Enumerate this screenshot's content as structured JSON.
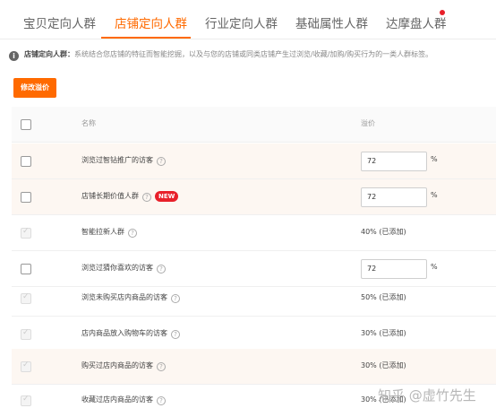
{
  "tabs": [
    {
      "label": "宝贝定向人群"
    },
    {
      "label": "店铺定向人群"
    },
    {
      "label": "行业定向人群"
    },
    {
      "label": "基础属性人群"
    },
    {
      "label": "达摩盘人群"
    }
  ],
  "active_tab": "店铺定向人群",
  "colors": {
    "accent": "#ff6a00",
    "badge": "#e8202a"
  },
  "info": {
    "icon": "info-icon",
    "title": "店铺定向人群：",
    "text": "系统结合您店铺的特征而智能挖掘，以及与您的店铺或同类店铺产生过浏览/收藏/加购/购买行为的一类人群标签。"
  },
  "modify_button": "修改溢价",
  "table": {
    "header": {
      "name": "名称",
      "premium": "溢价"
    },
    "rows": [
      {
        "name": "浏览过智钻推广的访客",
        "value": "72",
        "unit": "%"
      },
      {
        "name": "店铺长期价值人群",
        "badge": "NEW",
        "value": "72",
        "unit": "%"
      },
      {
        "name": "智能拉新人群",
        "premium": "40% (已添加)"
      },
      {
        "name": "浏览过猜你喜欢的访客",
        "value": "72",
        "unit": "%"
      },
      {
        "name": "浏览未购买店内商品的访客",
        "premium": "50% (已添加)"
      },
      {
        "name": "店内商品放入购物车的访客",
        "premium": "30% (已添加)"
      },
      {
        "name": "购买过店内商品的访客",
        "premium": "30% (已添加)"
      },
      {
        "name": "收藏过店内商品的访客",
        "premium": "30% (已添加)"
      }
    ]
  },
  "watermark": "知乎 @虚竹先生"
}
